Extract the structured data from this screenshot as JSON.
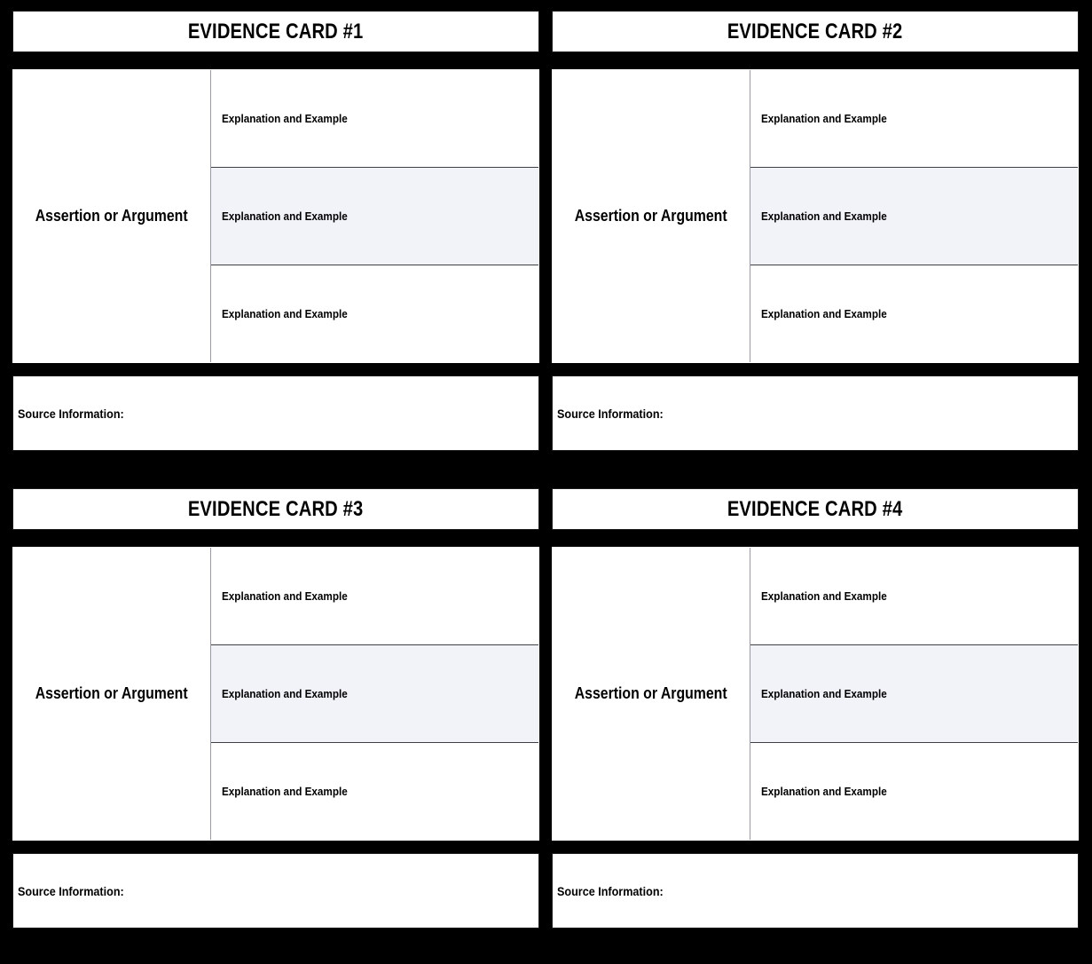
{
  "document": {
    "type": "graphic-organizer",
    "background_color": "#000000",
    "accent_row_color": "#f1f3f9",
    "text_color": "#000000",
    "cell_surface_color": "#ffffff",
    "grid_columns": 2,
    "grid_rows": 2
  },
  "labels": {
    "assertion": "Assertion or Argument",
    "explanation": "Explanation and Example",
    "source": "Source Information:"
  },
  "cards": [
    {
      "id": "card-1",
      "title": "EVIDENCE CARD #1",
      "assertion_label": "Assertion or Argument",
      "assertion_value": "",
      "explanations": [
        {
          "label": "Explanation and Example",
          "value": "",
          "shaded": false
        },
        {
          "label": "Explanation and Example",
          "value": "",
          "shaded": true
        },
        {
          "label": "Explanation and Example",
          "value": "",
          "shaded": false
        }
      ],
      "source_label": "Source Information:",
      "source_value": ""
    },
    {
      "id": "card-2",
      "title": "EVIDENCE CARD #2",
      "assertion_label": "Assertion or Argument",
      "assertion_value": "",
      "explanations": [
        {
          "label": "Explanation and Example",
          "value": "",
          "shaded": false
        },
        {
          "label": "Explanation and Example",
          "value": "",
          "shaded": true
        },
        {
          "label": "Explanation and Example",
          "value": "",
          "shaded": false
        }
      ],
      "source_label": "Source Information:",
      "source_value": ""
    },
    {
      "id": "card-3",
      "title": "EVIDENCE CARD #3",
      "assertion_label": "Assertion or Argument",
      "assertion_value": "",
      "explanations": [
        {
          "label": "Explanation and Example",
          "value": "",
          "shaded": false
        },
        {
          "label": "Explanation and Example",
          "value": "",
          "shaded": true
        },
        {
          "label": "Explanation and Example",
          "value": "",
          "shaded": false
        }
      ],
      "source_label": "Source Information:",
      "source_value": ""
    },
    {
      "id": "card-4",
      "title": "EVIDENCE CARD #4",
      "assertion_label": "Assertion or Argument",
      "assertion_value": "",
      "explanations": [
        {
          "label": "Explanation and Example",
          "value": "",
          "shaded": false
        },
        {
          "label": "Explanation and Example",
          "value": "",
          "shaded": true
        },
        {
          "label": "Explanation and Example",
          "value": "",
          "shaded": false
        }
      ],
      "source_label": "Source Information:",
      "source_value": ""
    }
  ]
}
